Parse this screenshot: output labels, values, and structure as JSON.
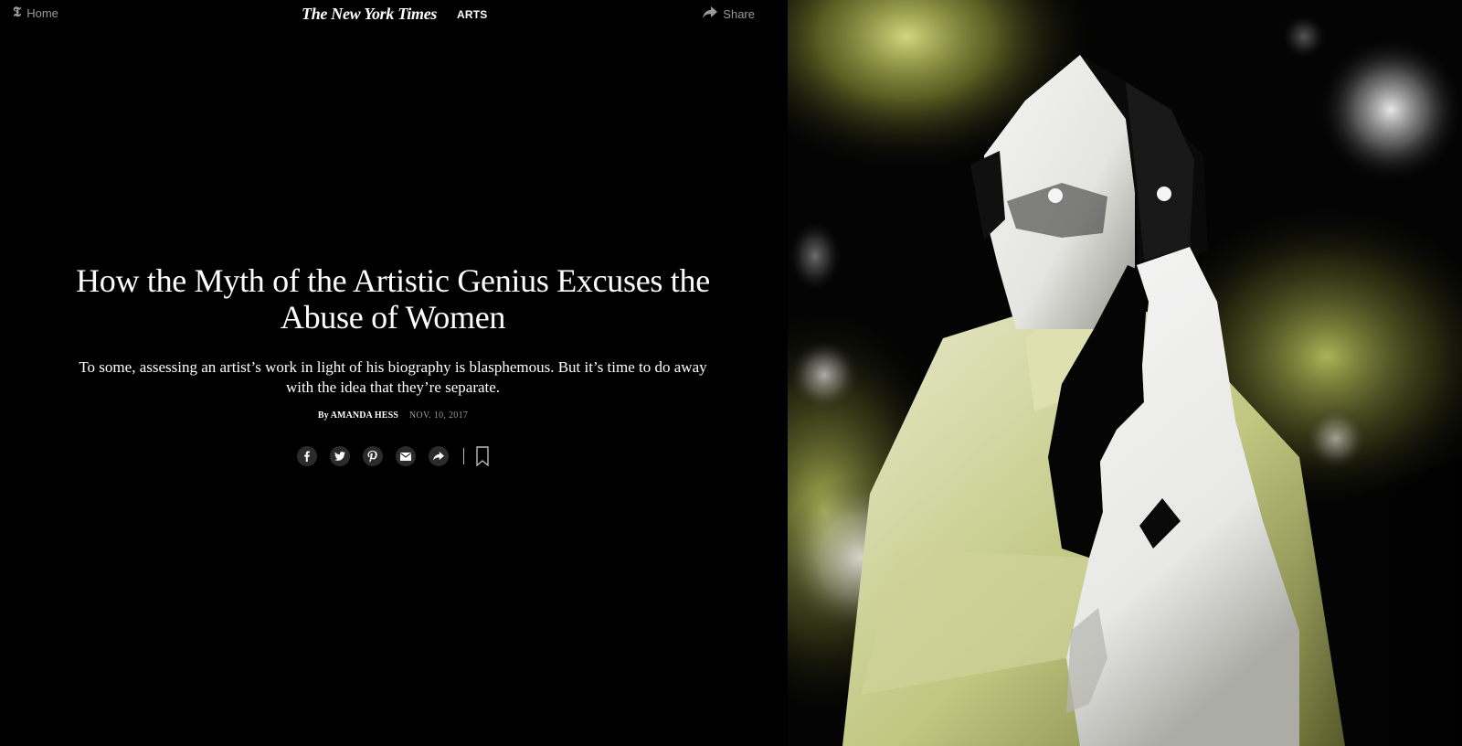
{
  "topbar": {
    "home_label": "Home",
    "masthead": "The New York Times",
    "section": "ARTS",
    "share_label": "Share"
  },
  "article": {
    "headline": "How the Myth of the Artistic Genius Excuses the Abuse of Women",
    "summary": "To some, assessing an artist’s work in light of his biography is blasphemous. But it’s time to do away with the idea that they’re separate.",
    "byline": "By AMANDA HESS",
    "date": "NOV. 10, 2017"
  },
  "share_tools": [
    "facebook-icon",
    "twitter-icon",
    "pinterest-icon",
    "email-icon",
    "share-icon",
    "bookmark-icon"
  ],
  "colors": {
    "background": "#000000",
    "text": "#ffffff",
    "muted": "#9a9a9a",
    "accent_glow": "#d9e27a"
  }
}
